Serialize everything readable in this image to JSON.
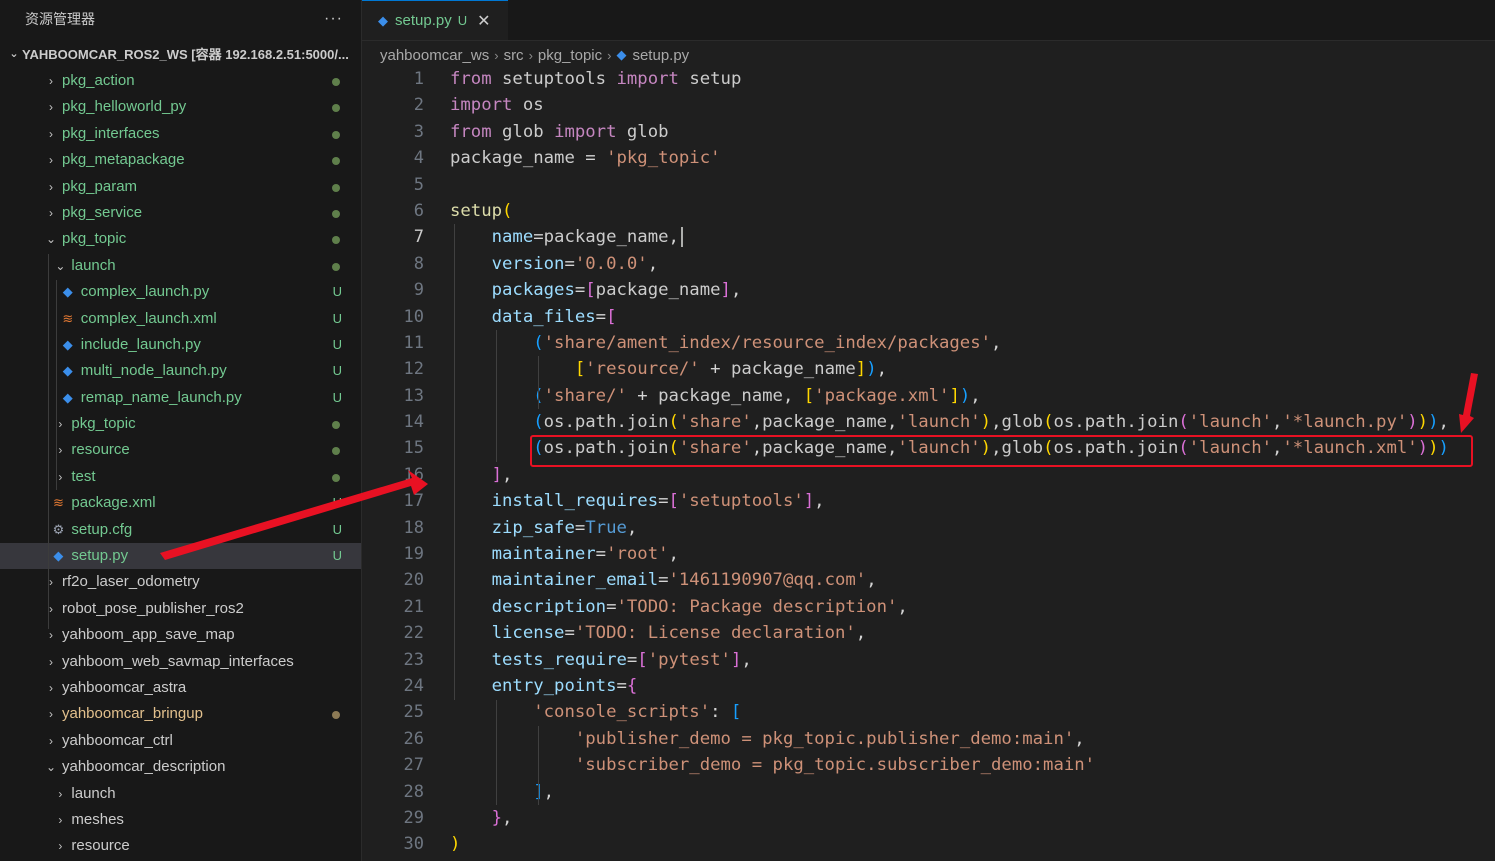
{
  "explorer": {
    "title": "资源管理器",
    "more_label": "···",
    "workspace": "YAHBOOMCAR_ROS2_WS [容器 192.168.2.51:5000/..."
  },
  "tree": [
    {
      "label": "pkg_action",
      "kind": "folder",
      "chev": "›",
      "color": "#73c991",
      "dot": "green"
    },
    {
      "label": "pkg_helloworld_py",
      "kind": "folder",
      "chev": "›",
      "color": "#73c991",
      "dot": "green"
    },
    {
      "label": "pkg_interfaces",
      "kind": "folder",
      "chev": "›",
      "color": "#73c991",
      "dot": "green"
    },
    {
      "label": "pkg_metapackage",
      "kind": "folder",
      "chev": "›",
      "color": "#73c991",
      "dot": "green"
    },
    {
      "label": "pkg_param",
      "kind": "folder",
      "chev": "›",
      "color": "#73c991",
      "dot": "green"
    },
    {
      "label": "pkg_service",
      "kind": "folder",
      "chev": "›",
      "color": "#73c991",
      "dot": "green"
    },
    {
      "label": "pkg_topic",
      "kind": "folder-open",
      "chev": "⌄",
      "color": "#73c991",
      "dot": "green"
    },
    {
      "label": "launch",
      "kind": "folder-open",
      "chev": "⌄",
      "color": "#73c991",
      "dot": "green",
      "depth": 1
    },
    {
      "label": "complex_launch.py",
      "kind": "python",
      "color": "#73c991",
      "badge": "U",
      "depth": 2
    },
    {
      "label": "complex_launch.xml",
      "kind": "xml",
      "color": "#73c991",
      "badge": "U",
      "depth": 2
    },
    {
      "label": "include_launch.py",
      "kind": "python",
      "color": "#73c991",
      "badge": "U",
      "depth": 2
    },
    {
      "label": "multi_node_launch.py",
      "kind": "python",
      "color": "#73c991",
      "badge": "U",
      "depth": 2
    },
    {
      "label": "remap_name_launch.py",
      "kind": "python",
      "color": "#73c991",
      "badge": "U",
      "depth": 2
    },
    {
      "label": "pkg_topic",
      "kind": "folder",
      "chev": "›",
      "color": "#73c991",
      "dot": "green",
      "depth": 1
    },
    {
      "label": "resource",
      "kind": "folder",
      "chev": "›",
      "color": "#73c991",
      "dot": "green",
      "depth": 1
    },
    {
      "label": "test",
      "kind": "folder",
      "chev": "›",
      "color": "#73c991",
      "dot": "green",
      "depth": 1
    },
    {
      "label": "package.xml",
      "kind": "xml",
      "color": "#73c991",
      "badge": "U",
      "depth": 1
    },
    {
      "label": "setup.cfg",
      "kind": "gear",
      "color": "#73c991",
      "badge": "U",
      "depth": 1
    },
    {
      "label": "setup.py",
      "kind": "python",
      "color": "#73c991",
      "badge": "U",
      "depth": 1,
      "selected": true
    },
    {
      "label": "rf2o_laser_odometry",
      "kind": "folder",
      "chev": "›",
      "color": "#cccccc"
    },
    {
      "label": "robot_pose_publisher_ros2",
      "kind": "folder",
      "chev": "›",
      "color": "#cccccc"
    },
    {
      "label": "yahboom_app_save_map",
      "kind": "folder",
      "chev": "›",
      "color": "#cccccc"
    },
    {
      "label": "yahboom_web_savmap_interfaces",
      "kind": "folder",
      "chev": "›",
      "color": "#cccccc"
    },
    {
      "label": "yahboomcar_astra",
      "kind": "folder",
      "chev": "›",
      "color": "#cccccc"
    },
    {
      "label": "yahboomcar_bringup",
      "kind": "folder",
      "chev": "›",
      "color": "#e2c08d",
      "dot": "brown"
    },
    {
      "label": "yahboomcar_ctrl",
      "kind": "folder",
      "chev": "›",
      "color": "#cccccc"
    },
    {
      "label": "yahboomcar_description",
      "kind": "folder-open",
      "chev": "⌄",
      "color": "#cccccc"
    },
    {
      "label": "launch",
      "kind": "folder",
      "chev": "›",
      "color": "#cccccc",
      "depth": 1
    },
    {
      "label": "meshes",
      "kind": "folder",
      "chev": "›",
      "color": "#cccccc",
      "depth": 1
    },
    {
      "label": "resource",
      "kind": "folder",
      "chev": "›",
      "color": "#cccccc",
      "depth": 1
    }
  ],
  "tab": {
    "file": "setup.py",
    "status": "U",
    "close": "✕",
    "icon": "python-icon"
  },
  "breadcrumb": [
    "yahboomcar_ws",
    "src",
    "pkg_topic",
    "setup.py"
  ],
  "active_line": 7,
  "code": [
    [
      [
        "from",
        "kw"
      ],
      [
        " setuptools ",
        "pl"
      ],
      [
        "import",
        "kw"
      ],
      [
        " setup",
        "pl"
      ]
    ],
    [
      [
        "import",
        "kw"
      ],
      [
        " os",
        "pl"
      ]
    ],
    [
      [
        "from",
        "kw"
      ],
      [
        " glob ",
        "pl"
      ],
      [
        "import",
        "kw"
      ],
      [
        " glob",
        "pl"
      ]
    ],
    [
      [
        "package_name",
        "pl"
      ],
      [
        " = ",
        "op"
      ],
      [
        "'pkg_topic'",
        "st"
      ]
    ],
    [],
    [
      [
        "setup",
        "fn"
      ],
      [
        "(",
        "b1"
      ]
    ],
    [
      [
        "    ",
        "pl"
      ],
      [
        "name",
        "va"
      ],
      [
        "=",
        "op"
      ],
      [
        "package_name",
        "pl"
      ],
      [
        ",",
        "op"
      ]
    ],
    [
      [
        "    ",
        "pl"
      ],
      [
        "version",
        "va"
      ],
      [
        "=",
        "op"
      ],
      [
        "'0.0.0'",
        "st"
      ],
      [
        ",",
        "op"
      ]
    ],
    [
      [
        "    ",
        "pl"
      ],
      [
        "packages",
        "va"
      ],
      [
        "=",
        "op"
      ],
      [
        "[",
        "b2"
      ],
      [
        "package_name",
        "pl"
      ],
      [
        "]",
        "b2"
      ],
      [
        ",",
        "op"
      ]
    ],
    [
      [
        "    ",
        "pl"
      ],
      [
        "data_files",
        "va"
      ],
      [
        "=",
        "op"
      ],
      [
        "[",
        "b2"
      ]
    ],
    [
      [
        "        ",
        "pl"
      ],
      [
        "(",
        "b3"
      ],
      [
        "'share/ament_index/resource_index/packages'",
        "st"
      ],
      [
        ",",
        "op"
      ]
    ],
    [
      [
        "            ",
        "pl"
      ],
      [
        "[",
        "b1"
      ],
      [
        "'resource/'",
        "st"
      ],
      [
        " + ",
        "op"
      ],
      [
        "package_name",
        "pl"
      ],
      [
        "]",
        "b1"
      ],
      [
        ")",
        "b3"
      ],
      [
        ",",
        "op"
      ]
    ],
    [
      [
        "        ",
        "pl"
      ],
      [
        "(",
        "b3"
      ],
      [
        "'share/'",
        "st"
      ],
      [
        " + ",
        "op"
      ],
      [
        "package_name",
        "pl"
      ],
      [
        ", ",
        "op"
      ],
      [
        "[",
        "b1"
      ],
      [
        "'package.xml'",
        "st"
      ],
      [
        "]",
        "b1"
      ],
      [
        ")",
        "b3"
      ],
      [
        ",",
        "op"
      ]
    ],
    [
      [
        "        ",
        "pl"
      ],
      [
        "(",
        "b3"
      ],
      [
        "os.path.join",
        "pl"
      ],
      [
        "(",
        "b1"
      ],
      [
        "'share'",
        "st"
      ],
      [
        ",",
        "op"
      ],
      [
        "package_name",
        "pl"
      ],
      [
        ",",
        "op"
      ],
      [
        "'launch'",
        "st"
      ],
      [
        ")",
        "b1"
      ],
      [
        ",",
        "op"
      ],
      [
        "glob",
        "pl"
      ],
      [
        "(",
        "b1"
      ],
      [
        "os.path.join",
        "pl"
      ],
      [
        "(",
        "b2"
      ],
      [
        "'launch'",
        "st"
      ],
      [
        ",",
        "op"
      ],
      [
        "'*launch.py'",
        "st"
      ],
      [
        ")",
        "b2"
      ],
      [
        ")",
        "b1"
      ],
      [
        ")",
        "b3"
      ],
      [
        ",",
        "op"
      ]
    ],
    [
      [
        "        ",
        "pl"
      ],
      [
        "(",
        "b3"
      ],
      [
        "os.path.join",
        "pl"
      ],
      [
        "(",
        "b1"
      ],
      [
        "'share'",
        "st"
      ],
      [
        ",",
        "op"
      ],
      [
        "package_name",
        "pl"
      ],
      [
        ",",
        "op"
      ],
      [
        "'launch'",
        "st"
      ],
      [
        ")",
        "b1"
      ],
      [
        ",",
        "op"
      ],
      [
        "glob",
        "pl"
      ],
      [
        "(",
        "b1"
      ],
      [
        "os.path.join",
        "pl"
      ],
      [
        "(",
        "b2"
      ],
      [
        "'launch'",
        "st"
      ],
      [
        ",",
        "op"
      ],
      [
        "'*launch.xml'",
        "st"
      ],
      [
        ")",
        "b2"
      ],
      [
        ")",
        "b1"
      ],
      [
        ")",
        "b3"
      ]
    ],
    [
      [
        "    ",
        "pl"
      ],
      [
        "]",
        "b2"
      ],
      [
        ",",
        "op"
      ]
    ],
    [
      [
        "    ",
        "pl"
      ],
      [
        "install_requires",
        "va"
      ],
      [
        "=",
        "op"
      ],
      [
        "[",
        "b2"
      ],
      [
        "'setuptools'",
        "st"
      ],
      [
        "]",
        "b2"
      ],
      [
        ",",
        "op"
      ]
    ],
    [
      [
        "    ",
        "pl"
      ],
      [
        "zip_safe",
        "va"
      ],
      [
        "=",
        "op"
      ],
      [
        "True",
        "kc"
      ],
      [
        ",",
        "op"
      ]
    ],
    [
      [
        "    ",
        "pl"
      ],
      [
        "maintainer",
        "va"
      ],
      [
        "=",
        "op"
      ],
      [
        "'root'",
        "st"
      ],
      [
        ",",
        "op"
      ]
    ],
    [
      [
        "    ",
        "pl"
      ],
      [
        "maintainer_email",
        "va"
      ],
      [
        "=",
        "op"
      ],
      [
        "'1461190907@qq.com'",
        "st"
      ],
      [
        ",",
        "op"
      ]
    ],
    [
      [
        "    ",
        "pl"
      ],
      [
        "description",
        "va"
      ],
      [
        "=",
        "op"
      ],
      [
        "'TODO: Package description'",
        "st"
      ],
      [
        ",",
        "op"
      ]
    ],
    [
      [
        "    ",
        "pl"
      ],
      [
        "license",
        "va"
      ],
      [
        "=",
        "op"
      ],
      [
        "'TODO: License declaration'",
        "st"
      ],
      [
        ",",
        "op"
      ]
    ],
    [
      [
        "    ",
        "pl"
      ],
      [
        "tests_require",
        "va"
      ],
      [
        "=",
        "op"
      ],
      [
        "[",
        "b2"
      ],
      [
        "'pytest'",
        "st"
      ],
      [
        "]",
        "b2"
      ],
      [
        ",",
        "op"
      ]
    ],
    [
      [
        "    ",
        "pl"
      ],
      [
        "entry_points",
        "va"
      ],
      [
        "=",
        "op"
      ],
      [
        "{",
        "b2"
      ]
    ],
    [
      [
        "        ",
        "pl"
      ],
      [
        "'console_scripts'",
        "st"
      ],
      [
        ": ",
        "op"
      ],
      [
        "[",
        "b3"
      ]
    ],
    [
      [
        "            ",
        "pl"
      ],
      [
        "'publisher_demo = pkg_topic.publisher_demo:main'",
        "st"
      ],
      [
        ",",
        "op"
      ]
    ],
    [
      [
        "            ",
        "pl"
      ],
      [
        "'subscriber_demo = pkg_topic.subscriber_demo:main'",
        "st"
      ]
    ],
    [
      [
        "        ",
        "pl"
      ],
      [
        "]",
        "b3"
      ],
      [
        ",",
        "op"
      ]
    ],
    [
      [
        "    ",
        "pl"
      ],
      [
        "}",
        "b2"
      ],
      [
        ",",
        "op"
      ]
    ],
    [
      [
        ")",
        "b1"
      ]
    ]
  ],
  "colors": {
    "accent": "#0078d4",
    "untracked": "#73c991",
    "highlight": "#e81123"
  }
}
